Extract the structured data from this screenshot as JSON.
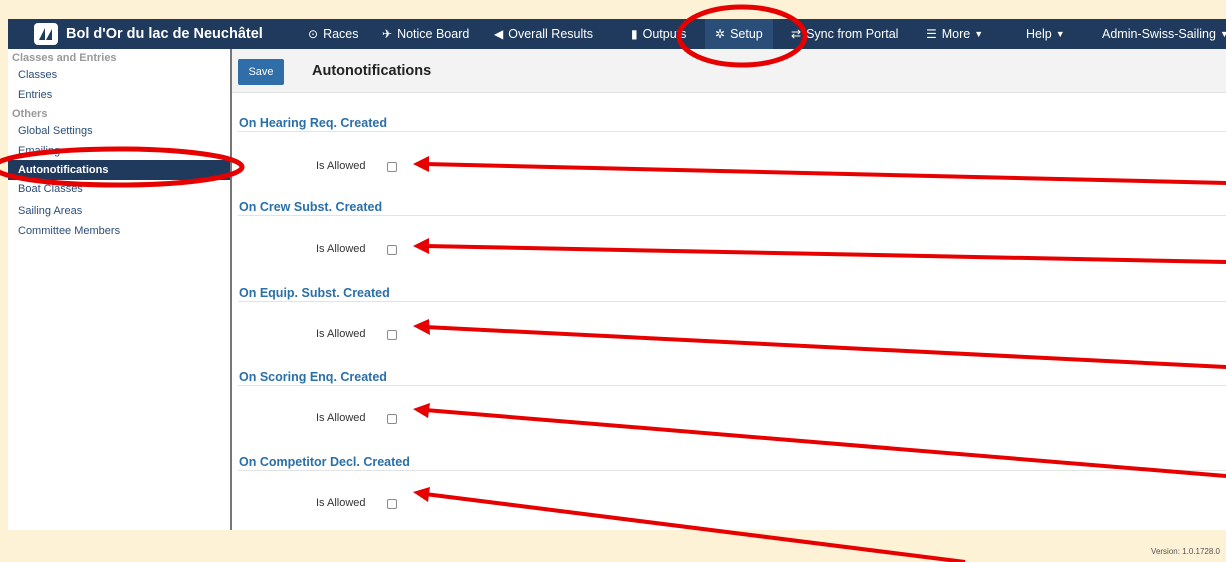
{
  "app": {
    "title": "Bol d'Or du lac de Neuchâtel"
  },
  "nav": {
    "races": "Races",
    "notice_board": "Notice Board",
    "overall_results": "Overall Results",
    "outputs": "Outputs",
    "setup": "Setup",
    "sync": "Sync from Portal",
    "more": "More",
    "help": "Help",
    "user": "Admin-Swiss-Sailing"
  },
  "sidebar": {
    "head1": "Classes and Entries",
    "item_classes": "Classes",
    "item_entries": "Entries",
    "head2": "Others",
    "item_global": "Global Settings",
    "item_emailing": "Emailing",
    "item_autonotifications": "Autonotifications",
    "item_boat_classes": "Boat Classes",
    "item_sailing_areas": "Sailing Areas",
    "item_committee": "Committee Members"
  },
  "toolbar": {
    "save_label": "Save",
    "title": "Autonotifications"
  },
  "sections": [
    {
      "title": "On Hearing Req. Created",
      "label": "Is Allowed",
      "checked": false
    },
    {
      "title": "On Crew Subst. Created",
      "label": "Is Allowed",
      "checked": false
    },
    {
      "title": "On Equip. Subst. Created",
      "label": "Is Allowed",
      "checked": false
    },
    {
      "title": "On Scoring Enq. Created",
      "label": "Is Allowed",
      "checked": false
    },
    {
      "title": "On Competitor Decl. Created",
      "label": "Is Allowed",
      "checked": false
    }
  ],
  "footer": {
    "version": "Version: 1.0.1728.0"
  },
  "colors": {
    "navbar": "#1f3a5c",
    "accent": "#2a6fa8",
    "annotation": "#e60000",
    "page_bg": "#fdf1d6"
  }
}
